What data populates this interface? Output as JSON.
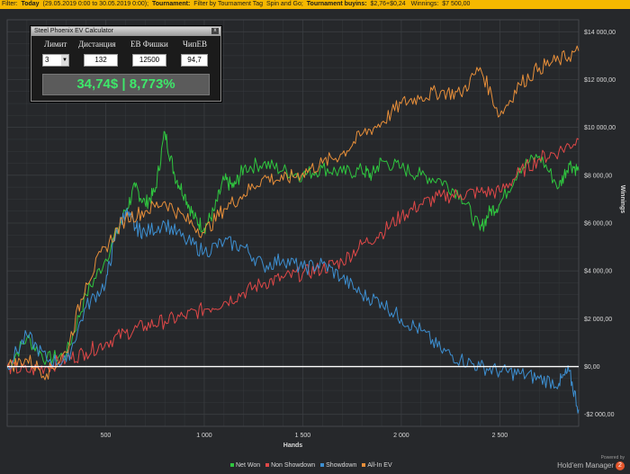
{
  "filter_bar": {
    "prefix": "Filter:",
    "today_label": "Today",
    "today_value": "(29.05.2019 0:00 to 30.05.2019 0:00);",
    "tournament_label": "Tournament:",
    "tournament_value": "Filter by Tournament Tag",
    "spin_label": "Spin and Go;",
    "buyins_label": "Tournament buyins:",
    "buyins_value": "$2,76+$0,24",
    "winnings_label": "Winnings:",
    "winnings_value": "$7 500,00"
  },
  "calculator": {
    "title": "Steel Phoenix EV Calculator",
    "close_label": "x",
    "headers": {
      "limit": "Лимит",
      "distance": "Дистанция",
      "ev_chips": "ЕВ Фишки",
      "chip_ev": "ЧипЕВ"
    },
    "values": {
      "limit": "3",
      "distance": "132",
      "ev_chips": "12500",
      "chip_ev": "94,7"
    },
    "result": "34,74$ | 8,773%"
  },
  "colors": {
    "background": "#26282b",
    "filter_bar": "#f5b800",
    "grid": "#3a3d41",
    "zero_line": "#ffffff",
    "net_won": "#2fc63f",
    "non_showdown": "#e04848",
    "showdown": "#3d8fd1",
    "all_in_ev": "#e88f3a"
  },
  "chart_data": {
    "type": "line",
    "xlabel": "Hands",
    "ylabel": "Winnings",
    "xlim": [
      0,
      2900
    ],
    "ylim": [
      -2500,
      14500
    ],
    "x_ticks": [
      500,
      1000,
      1500,
      2000,
      2500
    ],
    "x_tick_labels": [
      "500",
      "1 000",
      "1 500",
      "2 000",
      "2 500"
    ],
    "y_ticks": [
      -2000,
      0,
      2000,
      4000,
      6000,
      8000,
      10000,
      12000,
      14000
    ],
    "y_tick_labels": [
      "-$2 000,00",
      "$0,00",
      "$2 000,00",
      "$4 000,00",
      "$6 000,00",
      "$8 000,00",
      "$10 000,00",
      "$12 000,00",
      "$14 000,00"
    ],
    "grid": true,
    "legend_position": "bottom",
    "series": [
      {
        "name": "Net Won",
        "color": "#2fc63f",
        "x": [
          0,
          100,
          200,
          300,
          400,
          500,
          600,
          650,
          700,
          750,
          800,
          850,
          900,
          950,
          1000,
          1050,
          1100,
          1150,
          1200,
          1300,
          1400,
          1500,
          1600,
          1700,
          1800,
          1850,
          1900,
          2000,
          2100,
          2200,
          2300,
          2400,
          2450,
          2500,
          2600,
          2700,
          2800,
          2850,
          2900
        ],
        "y": [
          0,
          1200,
          300,
          500,
          3000,
          4500,
          6500,
          7500,
          6800,
          7300,
          9800,
          8000,
          7200,
          6200,
          5800,
          6500,
          7800,
          7500,
          8300,
          8500,
          8200,
          8000,
          8300,
          8100,
          8200,
          8000,
          8600,
          8300,
          8000,
          7800,
          7200,
          5700,
          6500,
          6800,
          8300,
          8800,
          7500,
          8500,
          8200
        ]
      },
      {
        "name": "Non Showdown",
        "color": "#e04848",
        "x": [
          0,
          100,
          200,
          300,
          400,
          500,
          600,
          700,
          800,
          900,
          1000,
          1100,
          1200,
          1300,
          1400,
          1500,
          1600,
          1700,
          1800,
          1900,
          2000,
          2100,
          2200,
          2300,
          2400,
          2500,
          2600,
          2700,
          2800,
          2900
        ],
        "y": [
          0,
          -200,
          0,
          300,
          600,
          1000,
          1400,
          1700,
          1900,
          2100,
          2400,
          2700,
          3100,
          3500,
          3700,
          3900,
          4100,
          4400,
          5100,
          5600,
          6300,
          6800,
          7100,
          7200,
          7300,
          7300,
          8100,
          8700,
          9000,
          9500
        ]
      },
      {
        "name": "Showdown",
        "color": "#3d8fd1",
        "x": [
          0,
          100,
          200,
          300,
          400,
          500,
          550,
          600,
          650,
          700,
          800,
          900,
          1000,
          1100,
          1200,
          1300,
          1400,
          1500,
          1600,
          1700,
          1800,
          1900,
          2000,
          2100,
          2200,
          2300,
          2400,
          2500,
          2600,
          2700,
          2800,
          2850,
          2900
        ],
        "y": [
          0,
          1300,
          300,
          200,
          2500,
          3500,
          5500,
          6500,
          5800,
          5600,
          6000,
          5300,
          4800,
          5200,
          5000,
          4200,
          4500,
          4100,
          4300,
          3700,
          3000,
          2700,
          2000,
          1500,
          700,
          300,
          0,
          -200,
          -300,
          -500,
          -700,
          -200,
          -1800
        ]
      },
      {
        "name": "All-In EV",
        "color": "#e88f3a",
        "x": [
          0,
          100,
          200,
          300,
          400,
          500,
          600,
          700,
          800,
          900,
          1000,
          1100,
          1200,
          1300,
          1400,
          1500,
          1600,
          1700,
          1800,
          1900,
          2000,
          2100,
          2200,
          2300,
          2400,
          2500,
          2600,
          2700,
          2800,
          2900
        ],
        "y": [
          0,
          300,
          -300,
          600,
          3500,
          5000,
          6200,
          6500,
          6900,
          6200,
          5600,
          6600,
          7200,
          7900,
          7800,
          8100,
          8500,
          8900,
          9700,
          10200,
          11000,
          11300,
          11500,
          11400,
          12500,
          10500,
          11800,
          12500,
          12800,
          13200
        ]
      }
    ]
  },
  "brand": {
    "powered_by": "Powered by",
    "name": "Hold'em Manager",
    "version": "2"
  }
}
